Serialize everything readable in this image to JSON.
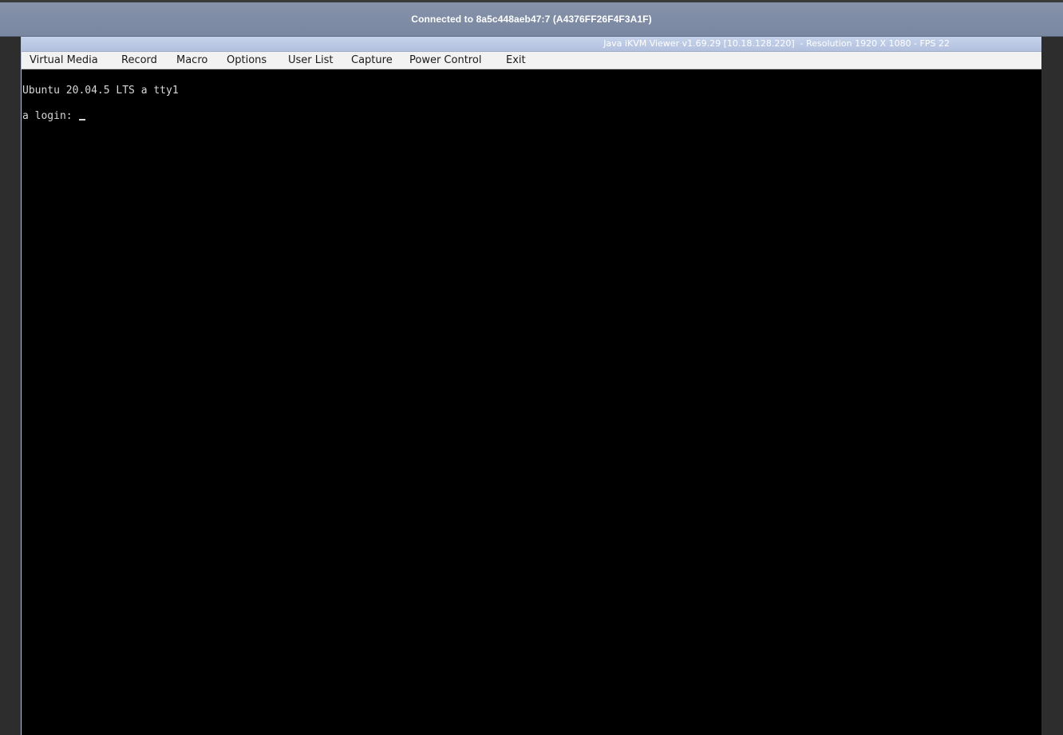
{
  "connection": {
    "text": "Connected to 8a5c448aeb47:7 (A4376FF26F4F3A1F)"
  },
  "viewer": {
    "title": "Java iKVM Viewer v1.69.29 [10.18.128.220]  - Resolution 1920 X 1080 - FPS 22"
  },
  "menu": {
    "items": [
      "Virtual Media",
      "Record",
      "Macro",
      "Options",
      "User List",
      "Capture",
      "Power Control",
      "Exit"
    ]
  },
  "terminal": {
    "line1": "Ubuntu 20.04.5 LTS a tty1",
    "login_prompt": "a login: "
  },
  "colors": {
    "connection_bar": "#7f8ca5",
    "viewer_titlebar": "#bccae5",
    "menubar": "#f2f2f2",
    "terminal_bg": "#000000",
    "terminal_fg": "#d8d8d8"
  }
}
